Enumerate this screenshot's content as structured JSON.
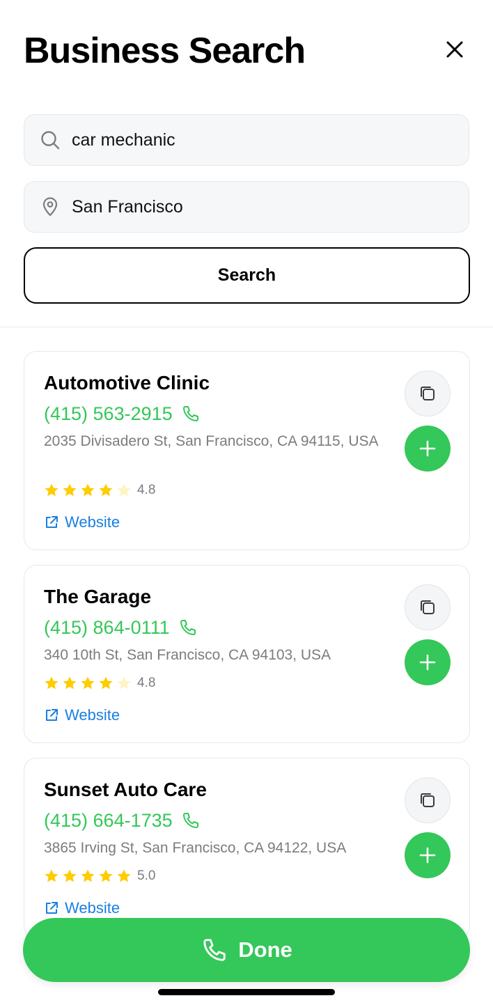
{
  "header": {
    "title": "Business Search",
    "close_icon": "close-icon"
  },
  "search": {
    "query_value": "car mechanic",
    "query_icon": "search-icon",
    "location_value": "San Francisco",
    "location_icon": "location-pin-icon",
    "button_label": "Search"
  },
  "results": [
    {
      "name": "Automotive Clinic",
      "phone": "(415) 563-2915",
      "address": "2035 Divisadero St, San Francisco, CA 94115, USA",
      "rating": 4.8,
      "rating_text": "4.8",
      "website_label": "Website"
    },
    {
      "name": "The Garage",
      "phone": "(415) 864-0111",
      "address": "340 10th St, San Francisco, CA 94103, USA",
      "rating": 4.8,
      "rating_text": "4.8",
      "website_label": "Website"
    },
    {
      "name": "Sunset Auto Care",
      "phone": "(415) 664-1735",
      "address": "3865 Irving St, San Francisco, CA 94122, USA",
      "rating": 5.0,
      "rating_text": "5.0",
      "website_label": "Website"
    }
  ],
  "footer": {
    "done_label": "Done",
    "done_icon": "phone-icon"
  },
  "colors": {
    "accent_green": "#34c759",
    "link_blue": "#1a7fe0",
    "star_gold": "#ffcc00",
    "star_empty": "#fff3c4",
    "secondary_text": "#7c7c80"
  }
}
